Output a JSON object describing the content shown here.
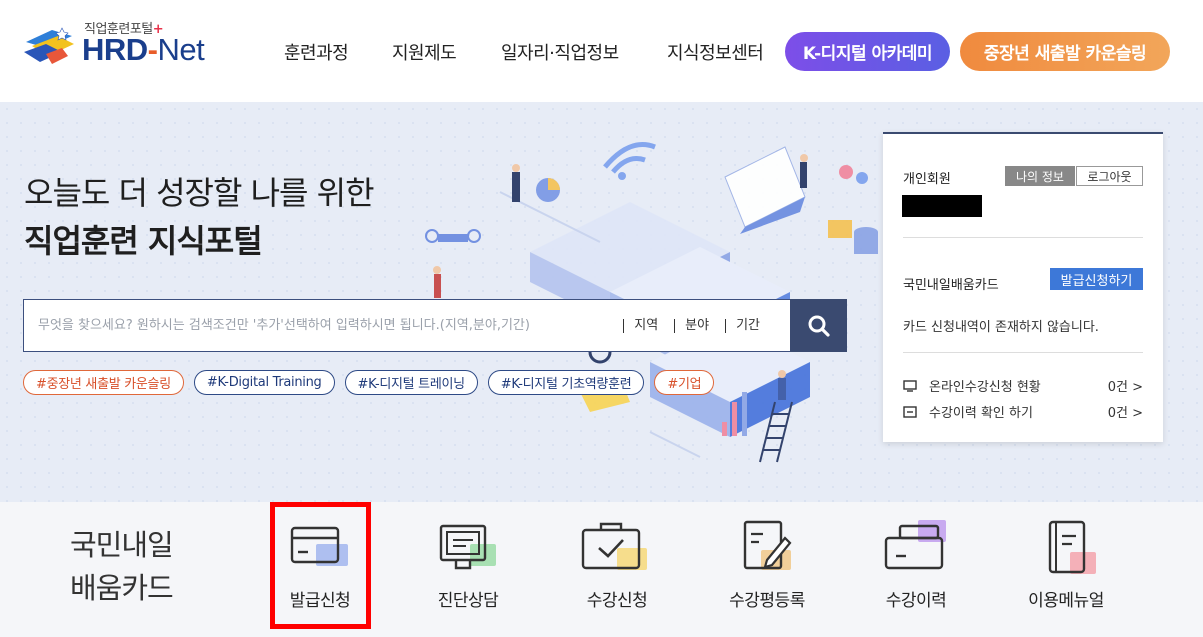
{
  "brand": {
    "subtitle": "직업훈련포털",
    "subtitle_plus": "+",
    "name_hrd": "HRD",
    "name_dash": "-",
    "name_net": "Net"
  },
  "nav": {
    "items": [
      "훈련과정",
      "지원제도",
      "일자리·직업정보",
      "지식정보센터"
    ],
    "pill_purple": "K-디지털 아카데미",
    "pill_orange": "중장년 새출발 카운슬링"
  },
  "hero": {
    "title_line1": "오늘도 더 성장할 나를 위한",
    "title_line2": "직업훈련 지식포털"
  },
  "search": {
    "placeholder": "무엇을 찾으세요? 원하시는 검색조건만 '추가'선택하여 입력하시면 됩니다.(지역,분야,기간)",
    "filters": [
      "지역",
      "분야",
      "기간"
    ]
  },
  "tags": [
    {
      "label": "#중장년 새출발 카운슬링",
      "color": "orange"
    },
    {
      "label": "#K-Digital Training",
      "color": "navy"
    },
    {
      "label": "#K-디지털 트레이닝",
      "color": "navy"
    },
    {
      "label": "#K-디지털 기초역량훈련",
      "color": "navy"
    },
    {
      "label": "#기업",
      "color": "orange"
    }
  ],
  "panel": {
    "member_type": "개인회원",
    "my_info": "나의 정보",
    "logout": "로그아웃",
    "card_title": "국민내일배움카드",
    "issue_button": "발급신청하기",
    "card_message": "카드 신청내역이 존재하지 않습니다.",
    "rows": [
      {
        "label": "온라인수강신청 현황",
        "count": "0건 >",
        "icon": "monitor-icon"
      },
      {
        "label": "수강이력 확인 하기",
        "count": "0건 >",
        "icon": "list-icon"
      }
    ]
  },
  "quick": {
    "title_line1": "국민내일",
    "title_line2": "배움카드",
    "items": [
      {
        "label": "발급신청",
        "icon": "card-icon"
      },
      {
        "label": "진단상담",
        "icon": "consult-monitor-icon"
      },
      {
        "label": "수강신청",
        "icon": "check-bag-icon"
      },
      {
        "label": "수강평등록",
        "icon": "review-pen-icon"
      },
      {
        "label": "수강이력",
        "icon": "history-folder-icon"
      },
      {
        "label": "이용메뉴얼",
        "icon": "manual-book-icon"
      }
    ]
  },
  "colors": {
    "purple": "#6a55e6",
    "orange": "#f0913f",
    "navy": "#3a4a70",
    "blue_button": "#3d78d8",
    "highlight": "#ff0000"
  }
}
